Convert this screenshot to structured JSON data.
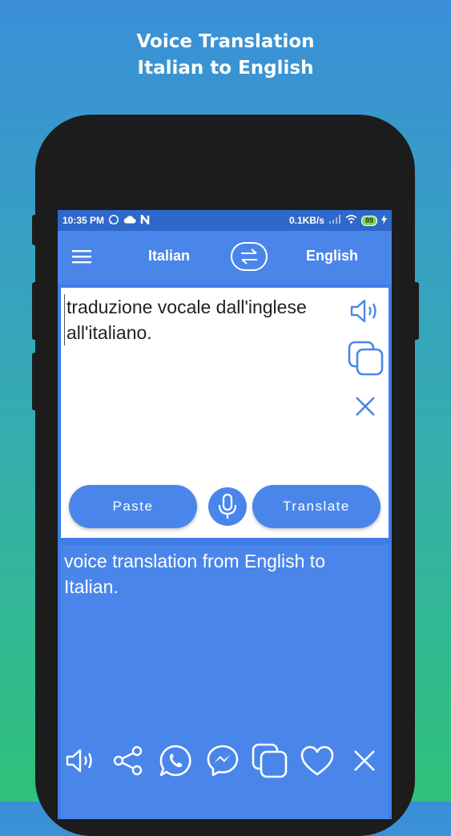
{
  "promo": {
    "line1": "Voice Translation",
    "line2": "Italian to English"
  },
  "status_bar": {
    "time": "10:35 PM",
    "speed": "0.1KB/s",
    "battery": "89"
  },
  "app_bar": {
    "source_language": "Italian",
    "target_language": "English"
  },
  "input": {
    "text": "traduzione vocale dall'inglese all'italiano."
  },
  "buttons": {
    "paste": "Paste",
    "translate": "Translate"
  },
  "output": {
    "text": "voice translation from English to Italian."
  },
  "icons": {
    "input_side": [
      "speaker-icon",
      "copy-icon",
      "close-icon"
    ],
    "bottom": [
      "speaker-icon",
      "share-icon",
      "whatsapp-icon",
      "messenger-icon",
      "copy-icon",
      "heart-icon",
      "close-icon"
    ]
  },
  "colors": {
    "accent": "#4a86ea",
    "status_bar": "#2f68c9",
    "phone_frame": "#1c1c1c"
  }
}
